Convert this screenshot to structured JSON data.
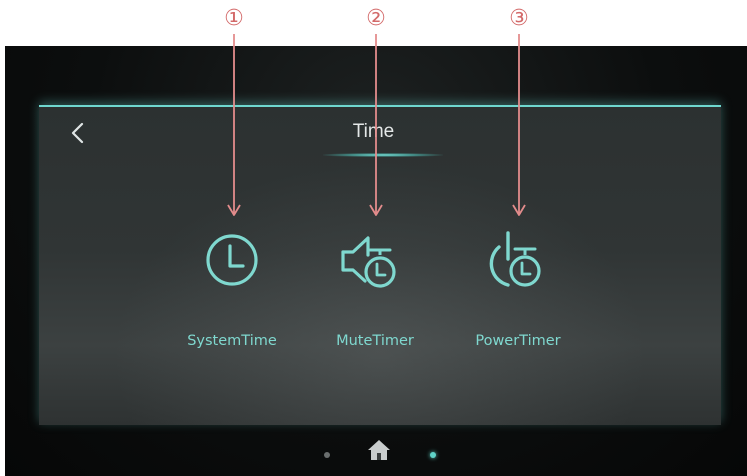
{
  "screen": {
    "title": "Time",
    "accent_color": "#6fd7cf"
  },
  "header": {
    "back_icon": "chevron-left-icon"
  },
  "tiles": [
    {
      "label": "SystemTime",
      "icon": "clock-icon"
    },
    {
      "label": "MuteTimer",
      "icon": "mute-timer-icon"
    },
    {
      "label": "PowerTimer",
      "icon": "power-timer-icon"
    }
  ],
  "annotations": [
    {
      "number": "①"
    },
    {
      "number": "②"
    },
    {
      "number": "③"
    }
  ],
  "bottom_nav": {
    "icon": "home-icon",
    "page_dots": 2,
    "active_dot": 2
  }
}
